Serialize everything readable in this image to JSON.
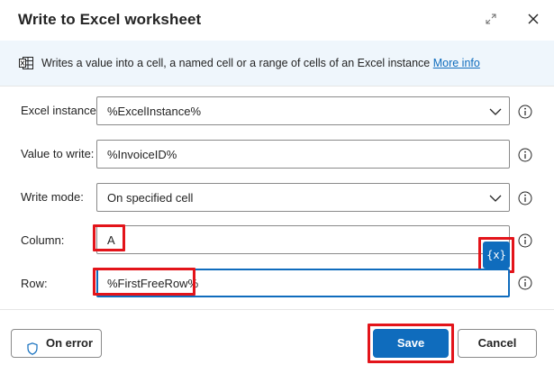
{
  "dialog": {
    "title": "Write to Excel worksheet"
  },
  "info": {
    "text": "Writes a value into a cell, a named cell or a range of cells of an Excel instance",
    "link": "More info"
  },
  "fields": {
    "excel_instance": {
      "label": "Excel instance:",
      "value": "%ExcelInstance%"
    },
    "value_to_write": {
      "label": "Value to write:",
      "value": "%InvoiceID%"
    },
    "write_mode": {
      "label": "Write mode:",
      "value": "On specified cell"
    },
    "column": {
      "label": "Column:",
      "value": "A"
    },
    "row": {
      "label": "Row:",
      "value": "%FirstFreeRow%"
    }
  },
  "variable_button": {
    "label": "{x}"
  },
  "footer": {
    "on_error": "On error",
    "save": "Save",
    "cancel": "Cancel"
  },
  "colors": {
    "accent": "#0f6cbd",
    "highlight": "#e3141a",
    "info_background": "#eff6fc"
  }
}
